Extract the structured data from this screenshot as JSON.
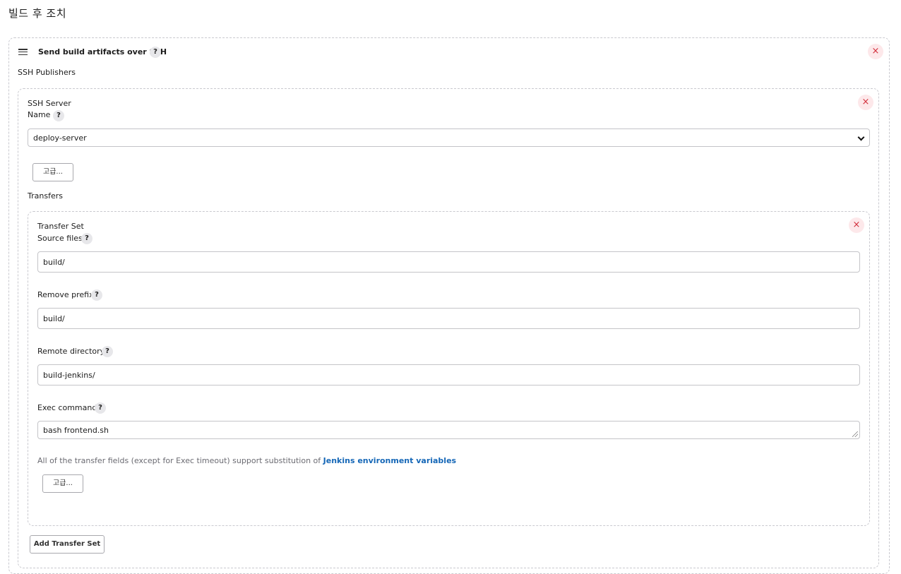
{
  "section_title": "빌드 후 조치",
  "publisher": {
    "title": "Send build artifacts over SSH",
    "publishers_label": "SSH Publishers",
    "server": {
      "title": "SSH Server",
      "name_label": "Name",
      "name_value": "deploy-server",
      "advanced_label": "고급...",
      "transfers_label": "Transfers",
      "transfer_set": {
        "title": "Transfer Set",
        "source_files_label": "Source files",
        "source_files_value": "build/",
        "remove_prefix_label": "Remove prefix",
        "remove_prefix_value": "build/",
        "remote_directory_label": "Remote directory",
        "remote_directory_value": "build-jenkins/",
        "exec_command_label": "Exec command",
        "exec_command_value": "bash frontend.sh",
        "note_text": "All of the transfer fields (except for Exec timeout) support substitution of ",
        "note_link": "Jenkins environment variables",
        "advanced_label": "고급..."
      },
      "add_transfer_label": "Add Transfer Set"
    }
  },
  "icons": {
    "help": "?",
    "close": "×"
  }
}
